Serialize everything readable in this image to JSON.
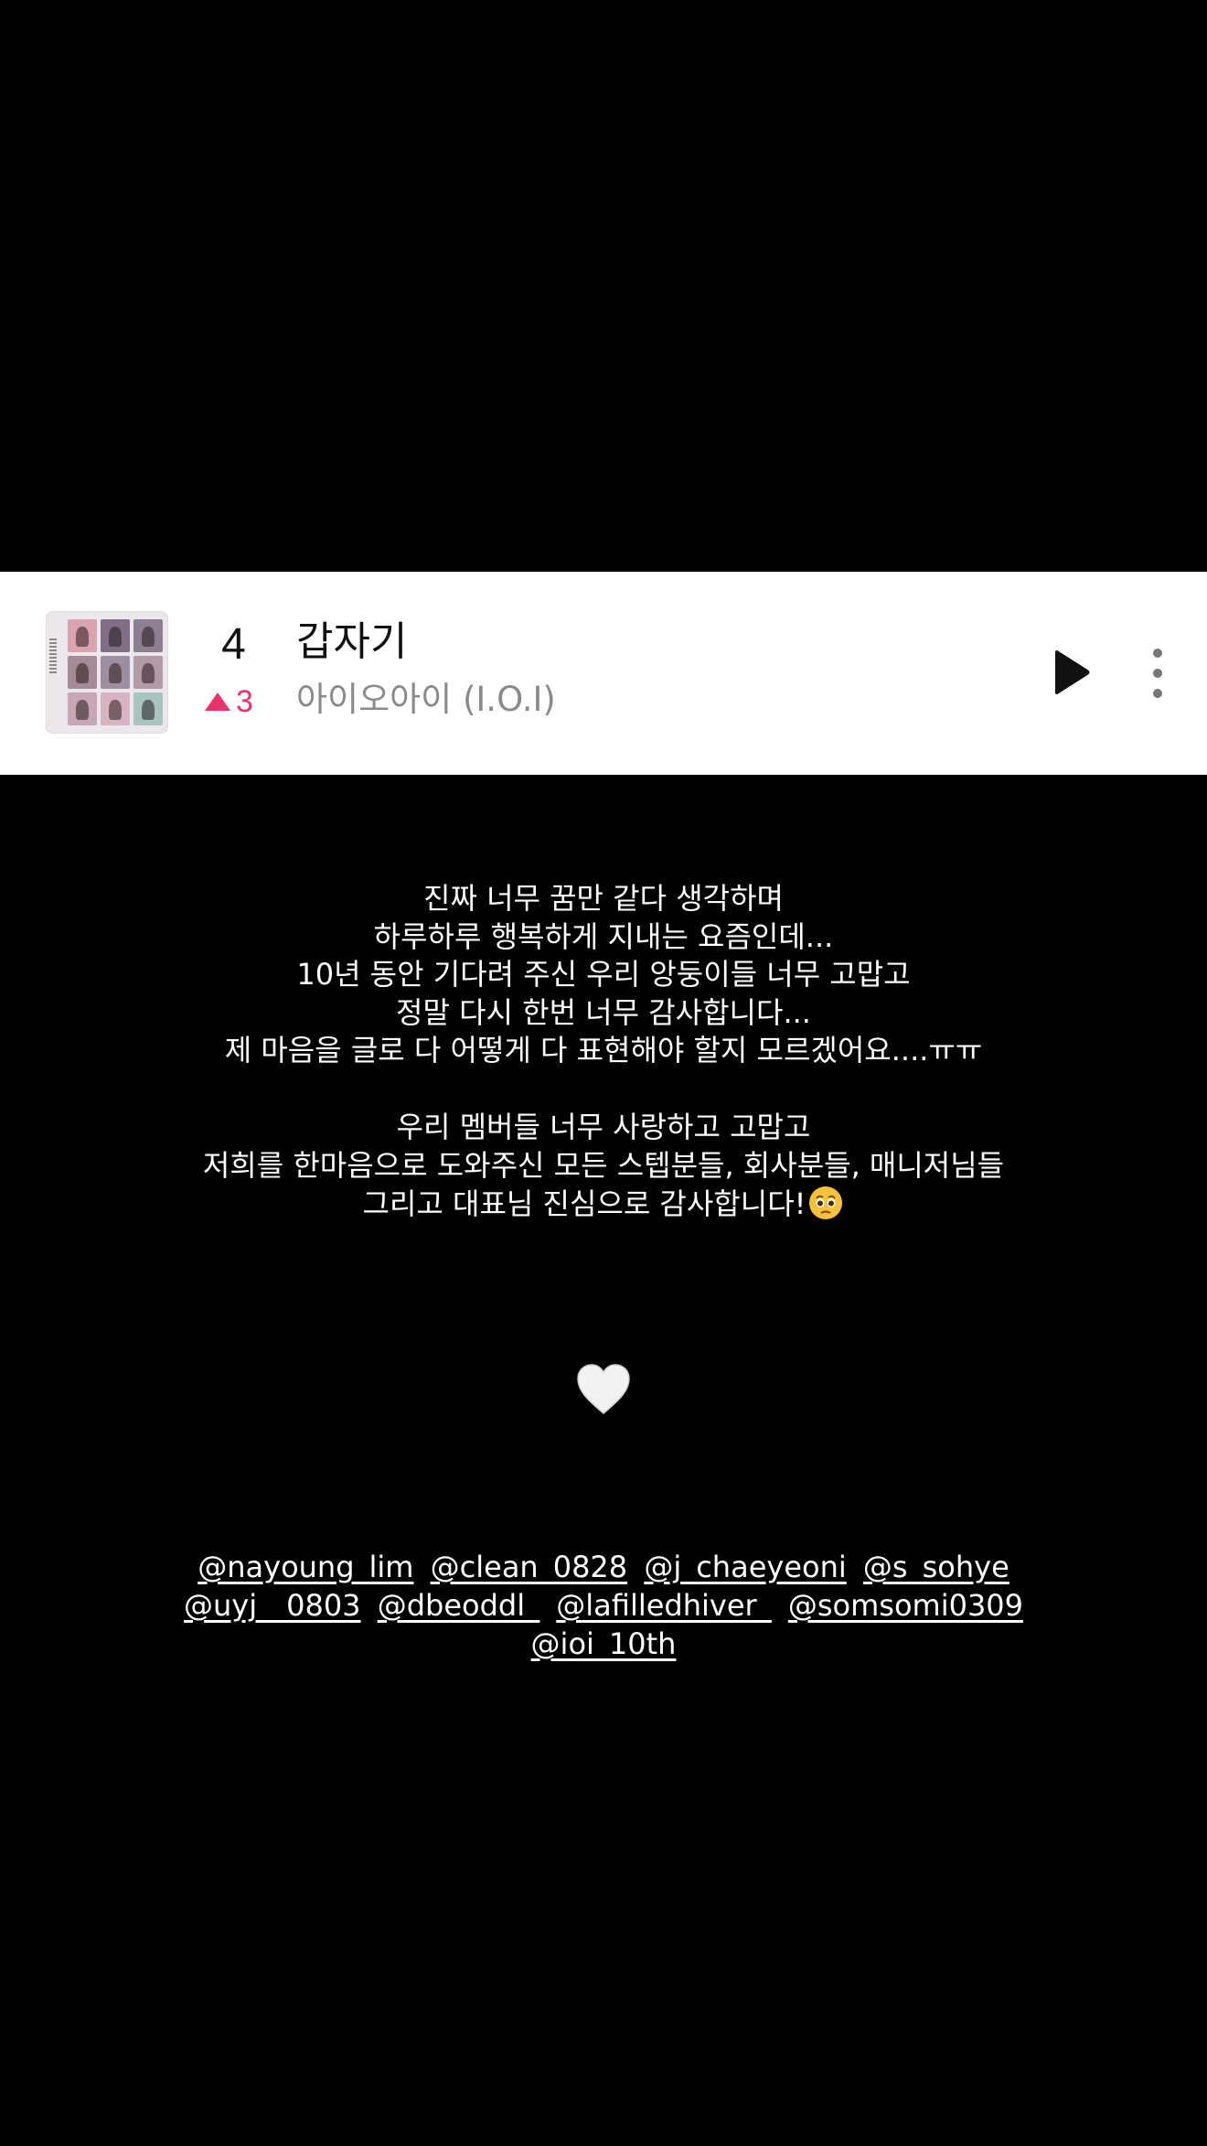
{
  "music": {
    "rank": "4",
    "rank_change": "3",
    "title": "갑자기",
    "artist": "아이오아이 (I.O.I)"
  },
  "story": {
    "paragraph1": [
      "진짜 너무 꿈만 같다 생각하며",
      "하루하루 행복하게 지내는 요즘인데...",
      "10년 동안 기다려 주신 우리 앙둥이들 너무 고맙고",
      "정말 다시 한번 너무 감사합니다...",
      "제 마음을 글로 다 어떻게 다 표현해야 할지 모르겠어요....ㅠㅠ"
    ],
    "paragraph2": [
      "우리 멤버들 너무 사랑하고 고맙고",
      "저희를 한마음으로 도와주신 모든 스텝분들, 회사분들, 매니저님들",
      "그리고 대표님 진심으로 감사합니다!"
    ],
    "emoji_icon": "holding-back-tears-face-emoji",
    "heart_icon": "white-heart-emoji"
  },
  "mentions": [
    "@nayoung_lim",
    "@clean_0828",
    "@j_chaeyeoni",
    "@s_sohye",
    "@uyj__0803",
    "@dbeoddl_",
    "@lafilledhiver_",
    "@somsomi0309",
    "@ioi_10th"
  ],
  "colors": {
    "background": "#000000",
    "card": "#ffffff",
    "rank_up": "#e8336d",
    "artist_text": "#8a8a8a"
  }
}
